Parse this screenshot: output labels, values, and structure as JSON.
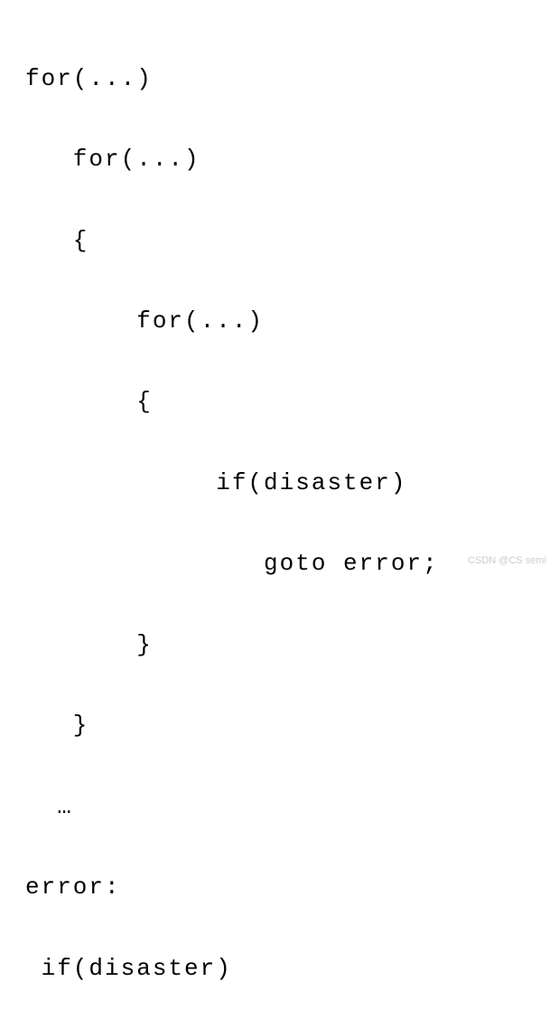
{
  "code": {
    "line1": "for(...)",
    "line2": "   for(...)",
    "line3": "   {",
    "line4": "       for(...)",
    "line5": "       {",
    "line6": "            if(disaster)",
    "line7": "               goto error;",
    "line8": "       }",
    "line9": "   }",
    "line10": "  …",
    "line11": "error:",
    "line12": " if(disaster)"
  },
  "watermark": "CSDN @CS semi"
}
